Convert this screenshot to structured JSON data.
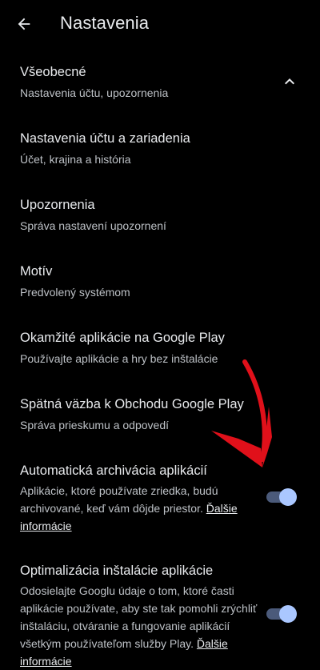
{
  "header": {
    "title": "Nastavenia",
    "back_icon": "arrow-back-icon"
  },
  "settings": {
    "general": {
      "title": "Všeobecné",
      "subtitle": "Nastavenia účtu, upozornenia",
      "chevron_icon": "chevron-up-icon"
    },
    "account": {
      "title": "Nastavenia účtu a zariadenia",
      "subtitle": "Účet, krajina a história"
    },
    "notifications": {
      "title": "Upozornenia",
      "subtitle": "Správa nastavení upozornení"
    },
    "theme": {
      "title": "Motív",
      "subtitle": "Predvolený systémom"
    },
    "instant_apps": {
      "title": "Okamžité aplikácie na Google Play",
      "subtitle": "Používajte aplikácie a hry bez inštalácie"
    },
    "feedback": {
      "title": "Spätná väzba k Obchodu Google Play",
      "subtitle": "Správa prieskumu a odpovedí"
    },
    "auto_archive": {
      "title": "Automatická archivácia aplikácií",
      "desc": "Aplikácie, ktoré používate zriedka, budú archivované, keď vám dôjde priestor.",
      "link": "Ďalšie informácie",
      "enabled": true
    },
    "install_optimization": {
      "title": "Optimalizácia inštalácie aplikácie",
      "desc": "Odosielajte Googlu údaje o tom, ktoré časti aplikácie používate, aby ste tak pomohli zrýchliť inštaláciu, otváranie a fungovanie aplikácií všetkým používateľom služby Play.",
      "link": "Ďalšie informácie",
      "enabled": true
    }
  },
  "colors": {
    "background": "#000000",
    "text_primary": "#e8eaed",
    "text_secondary": "#bdc1c6",
    "switch_track": "#4b5a7a",
    "switch_knob": "#aac7ff",
    "annotation_arrow": "#e0101a"
  }
}
